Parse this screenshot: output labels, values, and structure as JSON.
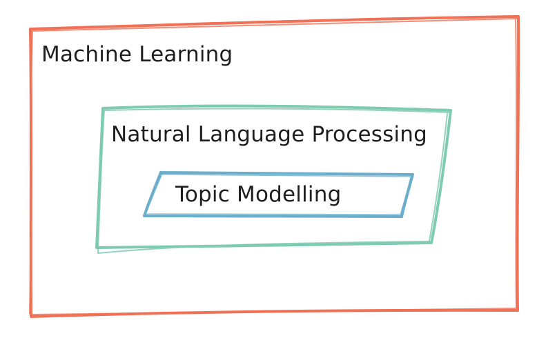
{
  "diagram": {
    "outer_box": {
      "label": "Machine Learning",
      "stroke_color": "#f07155"
    },
    "middle_box": {
      "label": "Natural Language Processing",
      "stroke_color": "#7fcbb0"
    },
    "inner_box": {
      "label": "Topic Modelling",
      "stroke_color": "#6aaecb"
    }
  }
}
